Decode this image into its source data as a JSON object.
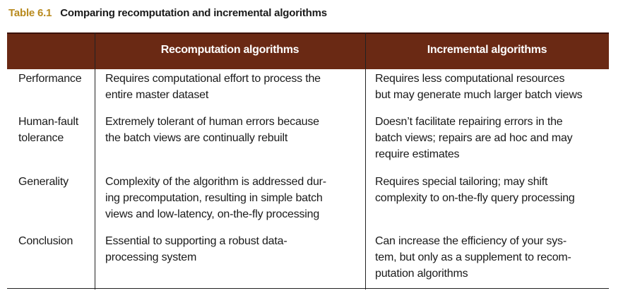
{
  "title": {
    "number": "Table 6.1",
    "text": "Comparing recomputation and incremental algorithms"
  },
  "headers": [
    "",
    "Recomputation algorithms",
    "Incremental algorithms"
  ],
  "rows": [
    {
      "label": [
        "Performance"
      ],
      "recomputation": [
        "Requires computational effort to process the",
        "entire master dataset"
      ],
      "incremental": [
        "Requires less computational resources",
        "but may generate much larger batch views"
      ]
    },
    {
      "label": [
        "Human-fault",
        "tolerance"
      ],
      "recomputation": [
        "Extremely tolerant of human errors because",
        "the batch views are continually rebuilt"
      ],
      "incremental": [
        "Doesn’t facilitate repairing errors in the",
        "batch views; repairs are ad hoc and may",
        "require estimates"
      ]
    },
    {
      "label": [
        "Generality"
      ],
      "recomputation": [
        "Complexity of the algorithm is addressed dur-",
        "ing precomputation, resulting in simple batch",
        "views and low-latency, on-the-fly processing"
      ],
      "incremental": [
        "Requires special tailoring; may shift",
        "complexity to on-the-fly query processing"
      ]
    },
    {
      "label": [
        "Conclusion"
      ],
      "recomputation": [
        "Essential to supporting a robust data-",
        "processing system"
      ],
      "incremental": [
        "Can increase the efficiency of your sys-",
        "tem, but only as a supplement to recom-",
        "putation algorithms"
      ]
    }
  ],
  "colors": {
    "header_bg": "#6a2914",
    "title_number": "#b88a1e"
  }
}
